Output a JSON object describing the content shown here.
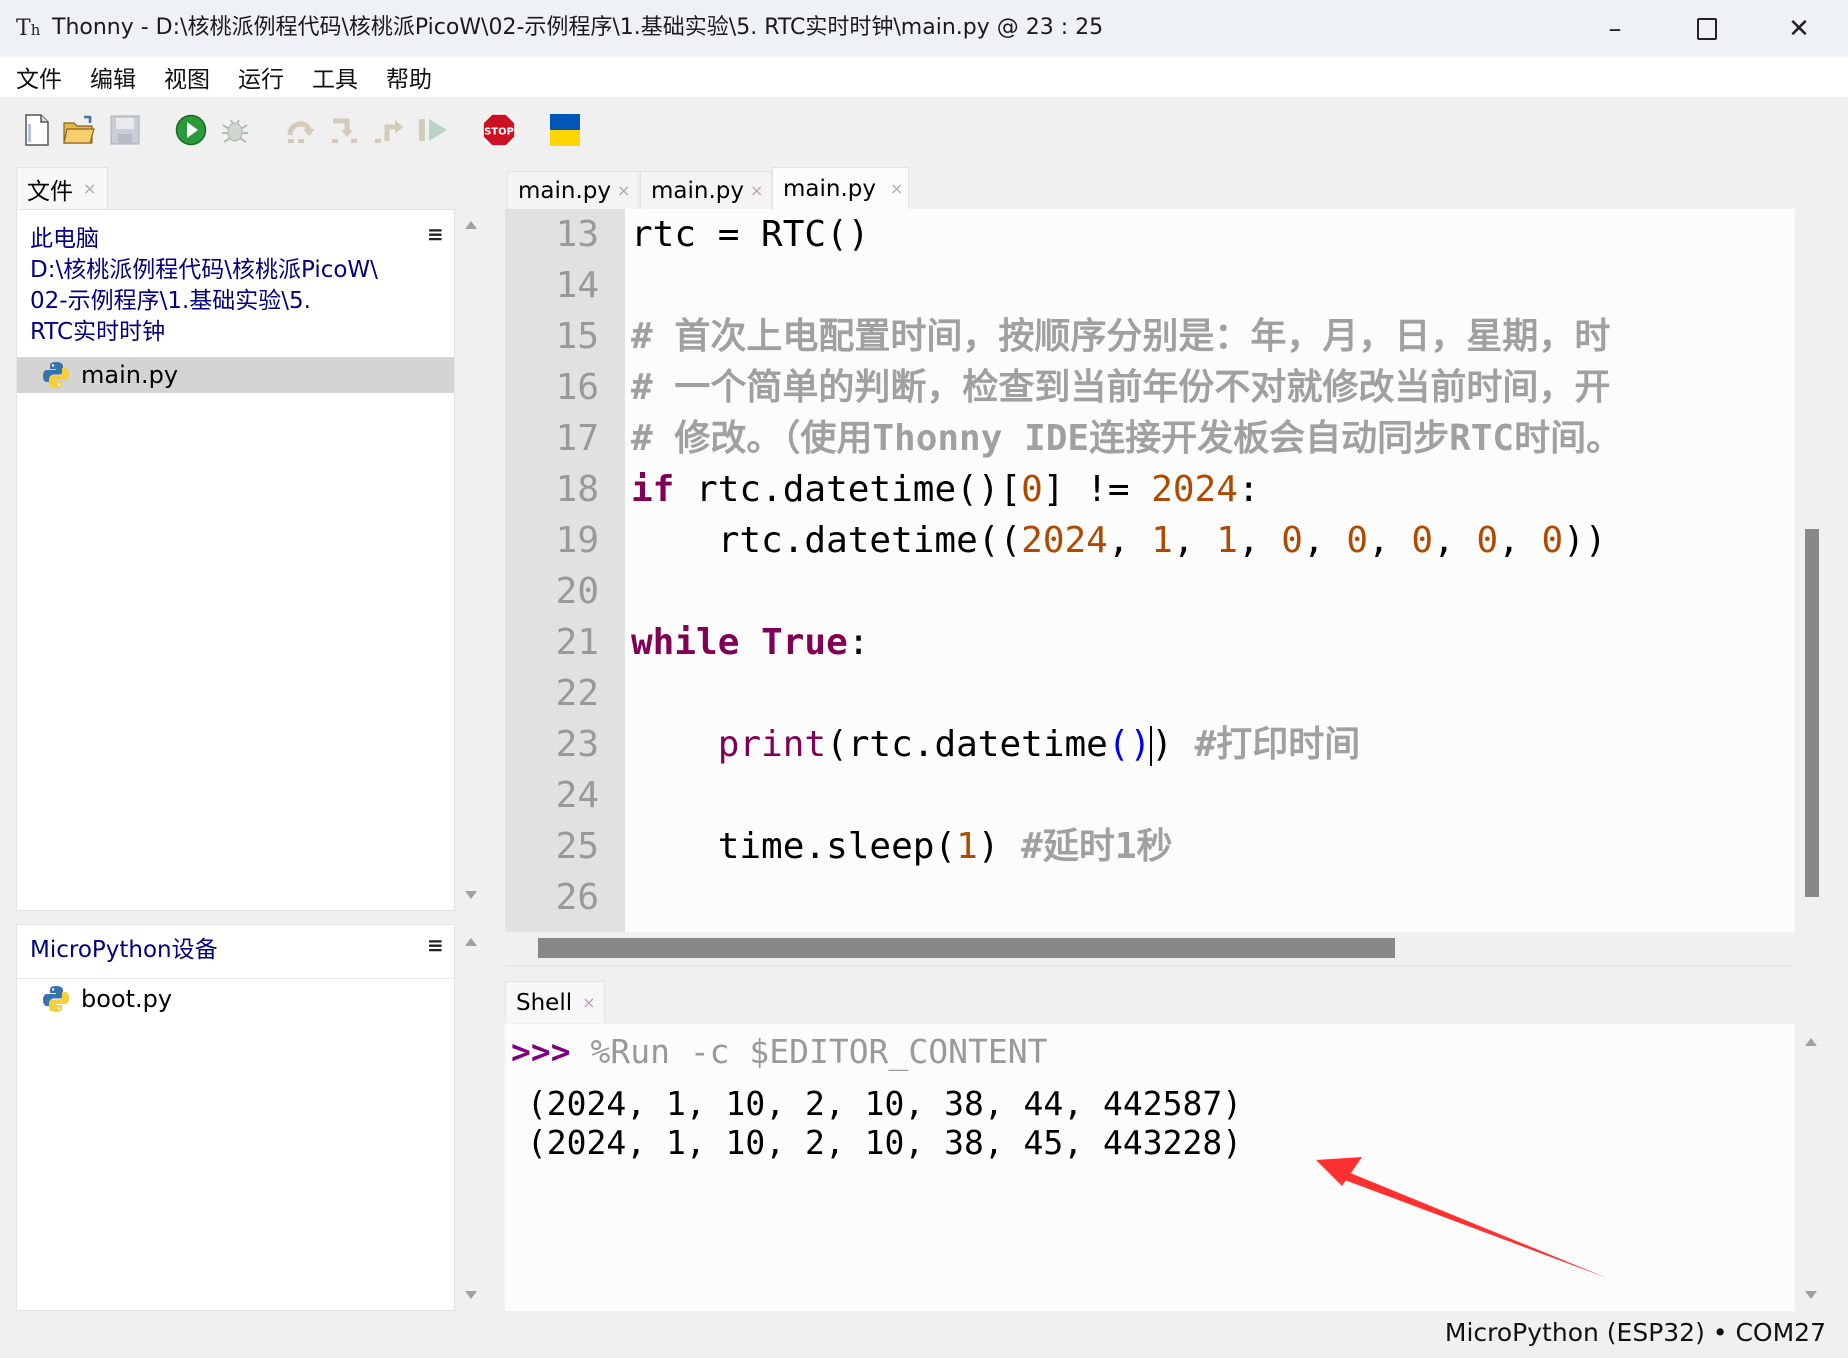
{
  "window": {
    "app_name": "Thonny",
    "title": "Thonny  -  D:\\核桃派例程代码\\核桃派PicoW\\02-示例程序\\1.基础实验\\5. RTC实时时钟\\main.py  @  23 : 25",
    "controls": {
      "minimize": "–",
      "maximize": "□",
      "close": "✕"
    }
  },
  "menu": [
    "文件",
    "编辑",
    "视图",
    "运行",
    "工具",
    "帮助"
  ],
  "toolbar": [
    {
      "name": "new-file",
      "enabled": true
    },
    {
      "name": "open-file",
      "enabled": true
    },
    {
      "name": "save-file",
      "enabled": false
    },
    {
      "name": "run",
      "enabled": true
    },
    {
      "name": "debug",
      "enabled": false
    },
    {
      "name": "step-over",
      "enabled": false
    },
    {
      "name": "step-into",
      "enabled": false
    },
    {
      "name": "step-out",
      "enabled": false
    },
    {
      "name": "resume",
      "enabled": false
    },
    {
      "name": "stop",
      "enabled": true,
      "label": "STOP"
    },
    {
      "name": "support-ukraine",
      "enabled": true
    }
  ],
  "files_panel": {
    "tab_label": "文件",
    "local": {
      "root_label": "此电脑",
      "path_lines": [
        "D:\\核桃派例程代码\\核桃派PicoW\\",
        "02-示例程序\\1.基础实验\\5.",
        "RTC实时时钟"
      ],
      "files": [
        {
          "name": "main.py",
          "selected": true
        }
      ]
    },
    "device": {
      "header": "MicroPython设备",
      "files": [
        {
          "name": "boot.py",
          "selected": false
        }
      ]
    },
    "menu_glyph": "≡"
  },
  "editor": {
    "tabs": [
      {
        "label": "main.py",
        "active": false
      },
      {
        "label": "main.py",
        "active": false
      },
      {
        "label": "main.py",
        "active": true
      }
    ],
    "close_glyph": "×",
    "lines": [
      {
        "n": "13",
        "tokens": [
          {
            "t": "rtc = RTC()",
            "c": ""
          }
        ]
      },
      {
        "n": "14",
        "tokens": []
      },
      {
        "n": "15",
        "tokens": [
          {
            "t": "# 首次上电配置时间，按顺序分别是：年，月，日，星期，时",
            "c": "cm"
          }
        ]
      },
      {
        "n": "16",
        "tokens": [
          {
            "t": "# 一个简单的判断，检查到当前年份不对就修改当前时间，开",
            "c": "cm"
          }
        ]
      },
      {
        "n": "17",
        "tokens": [
          {
            "t": "# 修改。（使用Thonny IDE连接开发板会自动同步RTC时间。",
            "c": "cm"
          }
        ]
      },
      {
        "n": "18",
        "tokens": [
          {
            "t": "if",
            "c": "kw"
          },
          {
            "t": " rtc.datetime()[",
            "c": ""
          },
          {
            "t": "0",
            "c": "num"
          },
          {
            "t": "] != ",
            "c": ""
          },
          {
            "t": "2024",
            "c": "num"
          },
          {
            "t": ":",
            "c": ""
          }
        ]
      },
      {
        "n": "19",
        "tokens": [
          {
            "t": "    rtc.datetime((",
            "c": ""
          },
          {
            "t": "2024",
            "c": "num"
          },
          {
            "t": ", ",
            "c": ""
          },
          {
            "t": "1",
            "c": "num"
          },
          {
            "t": ", ",
            "c": ""
          },
          {
            "t": "1",
            "c": "num"
          },
          {
            "t": ", ",
            "c": ""
          },
          {
            "t": "0",
            "c": "num"
          },
          {
            "t": ", ",
            "c": ""
          },
          {
            "t": "0",
            "c": "num"
          },
          {
            "t": ", ",
            "c": ""
          },
          {
            "t": "0",
            "c": "num"
          },
          {
            "t": ", ",
            "c": ""
          },
          {
            "t": "0",
            "c": "num"
          },
          {
            "t": ", ",
            "c": ""
          },
          {
            "t": "0",
            "c": "num"
          },
          {
            "t": "))",
            "c": ""
          }
        ]
      },
      {
        "n": "20",
        "tokens": []
      },
      {
        "n": "21",
        "tokens": [
          {
            "t": "while",
            "c": "kw"
          },
          {
            "t": " ",
            "c": ""
          },
          {
            "t": "True",
            "c": "kw"
          },
          {
            "t": ":",
            "c": ""
          }
        ]
      },
      {
        "n": "22",
        "tokens": []
      },
      {
        "n": "23",
        "tokens": [
          {
            "t": "    ",
            "c": ""
          },
          {
            "t": "print",
            "c": "bi"
          },
          {
            "t": "(rtc.datetime",
            "c": ""
          },
          {
            "t": "()",
            "c": "paren-hl"
          },
          {
            "t": "|caret|",
            "c": "caret"
          },
          {
            "t": ") ",
            "c": ""
          },
          {
            "t": "#打印时间",
            "c": "cm"
          }
        ]
      },
      {
        "n": "24",
        "tokens": []
      },
      {
        "n": "25",
        "tokens": [
          {
            "t": "    time.sleep(",
            "c": ""
          },
          {
            "t": "1",
            "c": "num"
          },
          {
            "t": ") ",
            "c": ""
          },
          {
            "t": "#延时1秒",
            "c": "cm"
          }
        ]
      },
      {
        "n": "26",
        "tokens": []
      }
    ],
    "cursor": {
      "line": 23,
      "col": 25
    }
  },
  "shell": {
    "tab_label": "Shell",
    "prompt": ">>>",
    "command": " %Run -c $EDITOR_CONTENT",
    "output": [
      " (2024, 1, 10, 2, 10, 38, 44, 442587)",
      " (2024, 1, 10, 2, 10, 38, 45, 443228)"
    ]
  },
  "statusbar": {
    "text": "MicroPython (ESP32)  •  COM27"
  },
  "annotation": {
    "type": "arrow",
    "color": "#ff3030",
    "points_to": "shell-output-line-2"
  },
  "colors": {
    "keyword": "#7f0055",
    "number": "#b04a00",
    "comment": "#a0a0a0",
    "paren_match": "#0000ff",
    "tree_link": "#000080",
    "stop_red": "#cc1122"
  }
}
